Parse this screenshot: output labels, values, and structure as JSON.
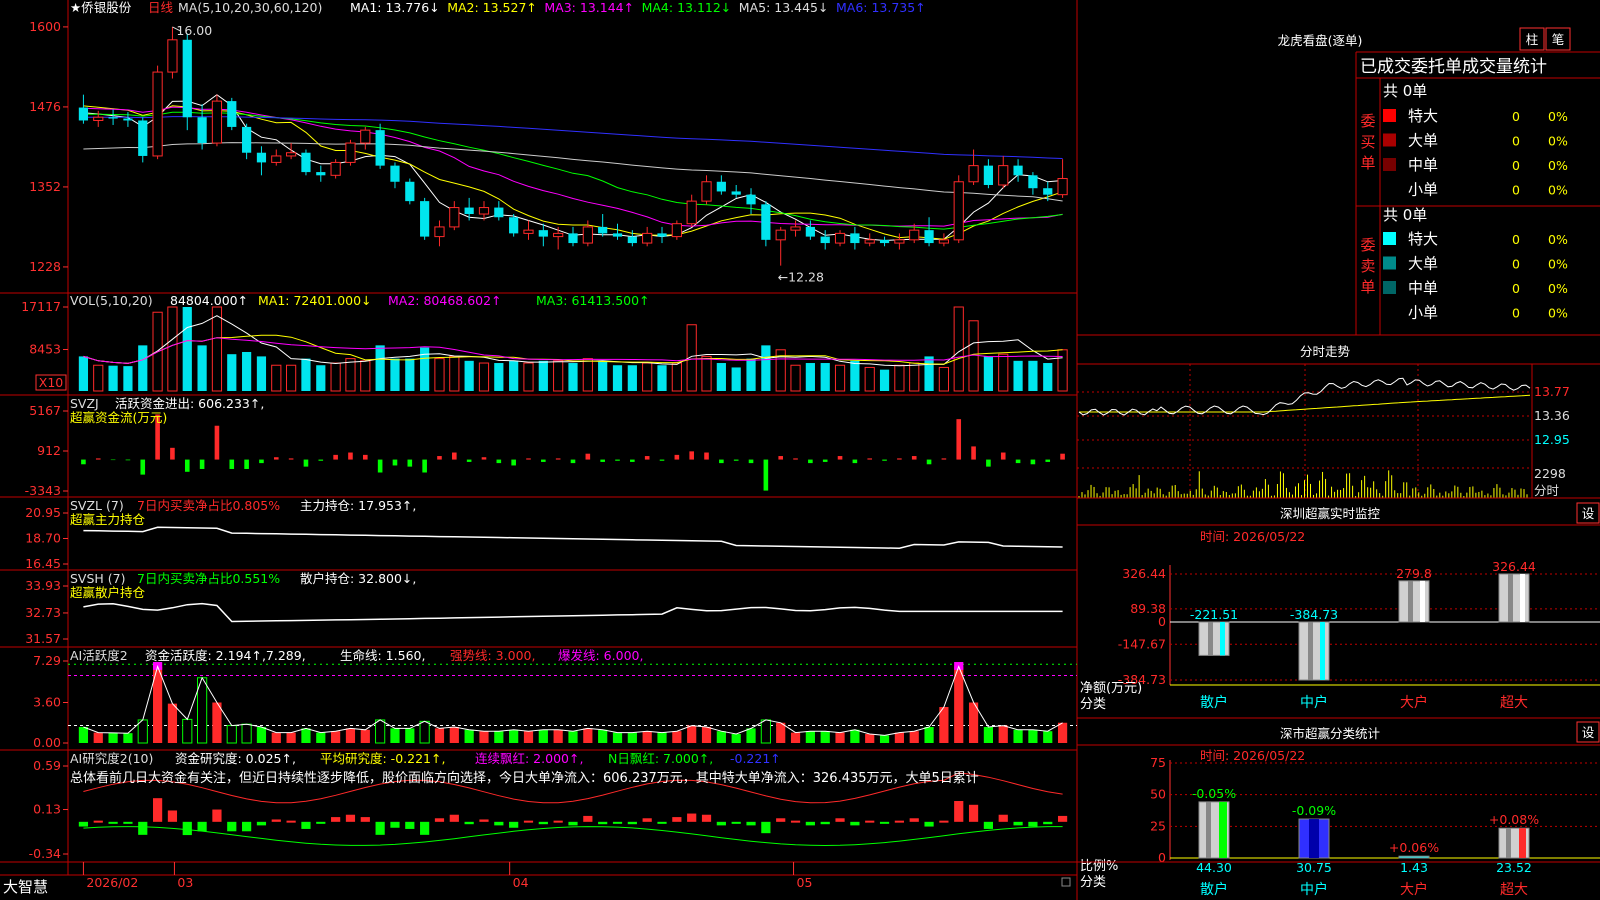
{
  "colors": {
    "up": "#ff2a2a",
    "down": "#00e5ee",
    "grid": "#c00000",
    "axis": "#ff3030",
    "white": "#ffffff",
    "yellow": "#ffff00",
    "magenta": "#ff00ff",
    "green": "#00ff00",
    "blue": "#3030ff",
    "gray": "#aaaaaa",
    "cyan": "#00ffff"
  },
  "main": {
    "title": "★侨银股份",
    "period": "日线",
    "ma_label": "MA(5,10,20,30,60,120)",
    "mas": [
      {
        "label": "MA1: 13.776↓",
        "color": "#ffffff"
      },
      {
        "label": "MA2: 13.527↑",
        "color": "#ffff00"
      },
      {
        "label": "MA3: 13.144↑",
        "color": "#ff00ff"
      },
      {
        "label": "MA4: 13.112↓",
        "color": "#00ff00"
      },
      {
        "label": "MA5: 13.445↓",
        "color": "#dddddd"
      },
      {
        "label": "MA6: 13.735↑",
        "color": "#3030ff"
      }
    ],
    "yticks": [
      "1600",
      "1476",
      "1352",
      "1228"
    ],
    "high_label": "16.00",
    "low_label": "←12.28",
    "ylim": [
      12.0,
      16.2
    ]
  },
  "vol": {
    "header": "VOL(5,10,20)",
    "value": "84804.000↑",
    "ma1": "MA1: 72401.000↓",
    "ma2": "MA2: 80468.602↑",
    "ma3": "MA3: 61413.500↑",
    "yticks": [
      "17117",
      "8453"
    ],
    "unit": "X10"
  },
  "svzj": {
    "header": "SVZJ",
    "label": "活跃资金进出: 606.233↑,",
    "sub": "超赢资金流(万元)",
    "yticks": [
      "5167",
      "912",
      "-3343"
    ]
  },
  "svzl": {
    "header": "SVZL (7)",
    "label1": "7日内买卖净占比0.805%",
    "label2": "主力持仓: 17.953↑,",
    "sub": "超赢主力持仓",
    "yticks": [
      "20.95",
      "18.70",
      "16.45"
    ]
  },
  "svsh": {
    "header": "SVSH (7)",
    "label1": "7日内买卖净占比0.551%",
    "label2": "散户持仓: 32.800↓,",
    "sub": "超赢散户持仓",
    "yticks": [
      "33.93",
      "32.73",
      "31.57"
    ]
  },
  "ai1": {
    "header": "AI活跃度2",
    "label1": "资金活跃度: 2.194↑,7.289,",
    "label2": "生命线: 1.560,",
    "label3": "强势线: 3.000,",
    "label4": "爆发线: 6.000,",
    "yticks": [
      "7.29",
      "3.60",
      "0.00"
    ]
  },
  "ai2": {
    "header": "AI研究度2(10)",
    "label1": "资金研究度: 0.025↑,",
    "label2": "平均研究度: -0.221↑,",
    "label3": "连续飘红: 2.000↑,",
    "label4": "N日飘红: 7.000↑,",
    "label5": "-0.221↑",
    "comment": "总体看前几日大资金有关注，但近日持续性逐步降低，股价面临方向选择，今日大单净流入：606.237万元，其中特大单净流入：326.435万元，大单5日累计",
    "yticks": [
      "0.59",
      "0.13",
      "-0.34"
    ]
  },
  "xaxis": {
    "brand": "大智慧",
    "labels": [
      "2026/02",
      "03",
      "04",
      "05"
    ]
  },
  "right": {
    "lhb_title": "龙虎看盘(逐单)",
    "btn1": "柱",
    "btn2": "笔",
    "stat_title": "已成交委托单成交量统计",
    "buy_label": "委买单",
    "sell_label": "委卖单",
    "buy_total": "共 0单",
    "sell_total": "共 0单",
    "buy_rows": [
      {
        "name": "特大",
        "v": "0",
        "p": "0%",
        "c": "#ff0000"
      },
      {
        "name": "大单",
        "v": "0",
        "p": "0%",
        "c": "#aa0000"
      },
      {
        "name": "中单",
        "v": "0",
        "p": "0%",
        "c": "#770000"
      },
      {
        "name": "小单",
        "v": "0",
        "p": "0%",
        "c": ""
      }
    ],
    "sell_rows": [
      {
        "name": "特大",
        "v": "0",
        "p": "0%",
        "c": "#00ffff"
      },
      {
        "name": "大单",
        "v": "0",
        "p": "0%",
        "c": "#008b8b"
      },
      {
        "name": "中单",
        "v": "0",
        "p": "0%",
        "c": "#006666"
      },
      {
        "name": "小单",
        "v": "0",
        "p": "0%",
        "c": ""
      }
    ],
    "intraday_title": "分时走势",
    "intraday_yticks": [
      "13.77",
      "13.36",
      "12.95"
    ],
    "intraday_vol": "2298",
    "intraday_unit": "分时",
    "sz_title": "深圳超赢实时监控",
    "sz_btn": "设",
    "sz_date": "时间: 2026/05/22",
    "sz_yticks": [
      "326.44",
      "89.38",
      "0",
      "-147.67",
      "-384.73"
    ],
    "sz_ylabel": "净额(万元)",
    "sz_xlabel": "分类",
    "sz_bars": [
      {
        "cat": "散户",
        "value": -221.51,
        "label": "-221.51"
      },
      {
        "cat": "中户",
        "value": -384.73,
        "label": "-384.73"
      },
      {
        "cat": "大户",
        "value": 279.8,
        "label": "279.8"
      },
      {
        "cat": "超大",
        "value": 326.44,
        "label": "326.44"
      }
    ],
    "cls_title": "深市超赢分类统计",
    "cls_btn": "设",
    "cls_date": "时间: 2026/05/22",
    "cls_yticks": [
      "75",
      "50",
      "25",
      "0"
    ],
    "cls_ylabel": "比例%",
    "cls_xlabel": "分类",
    "cls_bars": [
      {
        "cat": "散户",
        "value": 44.3,
        "label": "44.30",
        "delta": "-0.05%"
      },
      {
        "cat": "中户",
        "value": 30.75,
        "label": "30.75",
        "delta": "-0.09%"
      },
      {
        "cat": "大户",
        "value": 1.43,
        "label": "1.43",
        "delta": "+0.06%"
      },
      {
        "cat": "超大",
        "value": 23.52,
        "label": "23.52",
        "delta": "+0.08%"
      }
    ]
  },
  "chart_data": {
    "type": "candlestick",
    "title": "侨银股份 日线",
    "ylim": [
      12.0,
      16.2
    ],
    "candles": [
      [
        14.75,
        14.55,
        14.95,
        14.5
      ],
      [
        14.55,
        14.6,
        14.7,
        14.45
      ],
      [
        14.6,
        14.58,
        14.72,
        14.48
      ],
      [
        14.58,
        14.55,
        14.68,
        14.45
      ],
      [
        14.55,
        14.0,
        14.6,
        13.9
      ],
      [
        14.0,
        15.3,
        15.4,
        13.95
      ],
      [
        15.3,
        15.8,
        16.0,
        15.2
      ],
      [
        15.8,
        14.6,
        15.9,
        14.4
      ],
      [
        14.6,
        14.2,
        14.8,
        14.1
      ],
      [
        14.2,
        14.85,
        14.95,
        14.15
      ],
      [
        14.85,
        14.45,
        14.9,
        14.4
      ],
      [
        14.45,
        14.05,
        14.5,
        13.95
      ],
      [
        14.05,
        13.9,
        14.15,
        13.7
      ],
      [
        13.9,
        14.0,
        14.1,
        13.85
      ],
      [
        14.0,
        14.05,
        14.2,
        13.95
      ],
      [
        14.05,
        13.75,
        14.1,
        13.7
      ],
      [
        13.75,
        13.7,
        13.85,
        13.6
      ],
      [
        13.7,
        13.9,
        13.95,
        13.65
      ],
      [
        13.9,
        14.2,
        14.25,
        13.85
      ],
      [
        14.2,
        14.4,
        14.45,
        14.1
      ],
      [
        14.4,
        13.85,
        14.5,
        13.8
      ],
      [
        13.85,
        13.6,
        13.9,
        13.5
      ],
      [
        13.6,
        13.3,
        13.65,
        13.25
      ],
      [
        13.3,
        12.75,
        13.35,
        12.7
      ],
      [
        12.75,
        12.9,
        13.0,
        12.6
      ],
      [
        12.9,
        13.2,
        13.3,
        12.85
      ],
      [
        13.2,
        13.1,
        13.35,
        13.0
      ],
      [
        13.1,
        13.2,
        13.3,
        13.0
      ],
      [
        13.2,
        13.05,
        13.3,
        13.0
      ],
      [
        13.05,
        12.8,
        13.1,
        12.75
      ],
      [
        12.8,
        12.85,
        13.0,
        12.7
      ],
      [
        12.85,
        12.75,
        12.95,
        12.6
      ],
      [
        12.75,
        12.8,
        12.9,
        12.55
      ],
      [
        12.8,
        12.65,
        12.9,
        12.6
      ],
      [
        12.65,
        12.9,
        13.0,
        12.6
      ],
      [
        12.9,
        12.8,
        13.1,
        12.75
      ],
      [
        12.8,
        12.75,
        12.95,
        12.7
      ],
      [
        12.75,
        12.65,
        12.85,
        12.6
      ],
      [
        12.65,
        12.8,
        12.9,
        12.6
      ],
      [
        12.8,
        12.75,
        12.9,
        12.65
      ],
      [
        12.75,
        12.95,
        13.0,
        12.7
      ],
      [
        12.95,
        13.3,
        13.4,
        12.9
      ],
      [
        13.3,
        13.6,
        13.7,
        13.25
      ],
      [
        13.6,
        13.45,
        13.7,
        13.4
      ],
      [
        13.45,
        13.4,
        13.55,
        13.35
      ],
      [
        13.4,
        13.25,
        13.5,
        13.1
      ],
      [
        13.25,
        12.7,
        13.3,
        12.6
      ],
      [
        12.7,
        12.85,
        12.9,
        12.3
      ],
      [
        12.85,
        12.9,
        13.0,
        12.75
      ],
      [
        12.9,
        12.75,
        13.0,
        12.7
      ],
      [
        12.75,
        12.65,
        12.85,
        12.55
      ],
      [
        12.65,
        12.8,
        12.85,
        12.6
      ],
      [
        12.8,
        12.65,
        12.9,
        12.55
      ],
      [
        12.65,
        12.7,
        12.8,
        12.6
      ],
      [
        12.7,
        12.65,
        12.75,
        12.6
      ],
      [
        12.65,
        12.7,
        12.8,
        12.55
      ],
      [
        12.7,
        12.85,
        12.95,
        12.65
      ],
      [
        12.85,
        12.65,
        13.05,
        12.6
      ],
      [
        12.65,
        12.7,
        12.8,
        12.6
      ],
      [
        12.7,
        13.6,
        13.7,
        12.65
      ],
      [
        13.6,
        13.85,
        14.1,
        13.55
      ],
      [
        13.85,
        13.55,
        13.95,
        13.5
      ],
      [
        13.55,
        13.85,
        14.0,
        13.5
      ],
      [
        13.85,
        13.7,
        13.95,
        13.6
      ],
      [
        13.7,
        13.5,
        13.75,
        13.4
      ],
      [
        13.5,
        13.4,
        13.6,
        13.3
      ],
      [
        13.4,
        13.65,
        13.95,
        13.35
      ]
    ]
  }
}
